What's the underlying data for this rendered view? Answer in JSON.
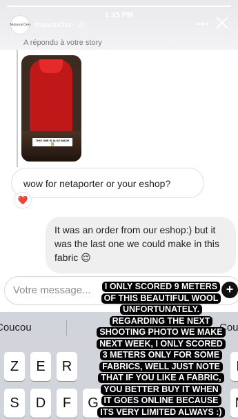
{
  "status": {
    "time": "1:15 PM",
    "story_progress": 1.0
  },
  "header": {
    "avatar_text": "MaisonCléo",
    "author": "maisoncleo",
    "time_ago": "2h",
    "more_icon": "more-horizontal-icon",
    "close_icon": "close-icon"
  },
  "reply": {
    "label": "A répondu à votre story",
    "thumb_caption": "THIS ONE IS ALSO MADE ✅"
  },
  "messages": {
    "incoming": "wow for netaporter or your eshop?",
    "reaction": "❤️",
    "outgoing": "It was an order from our eshop:) but it was the last one we could make in this fabric 😌"
  },
  "composer": {
    "placeholder": "Votre message...",
    "send_icon": "plus-icon"
  },
  "keyboard": {
    "suggestions": [
      "Coucou",
      "Cour"
    ],
    "row1": [
      "Z",
      "E",
      "R",
      "",
      "",
      "",
      "",
      "",
      "",
      "P"
    ],
    "row2": [
      "S",
      "D",
      "F",
      "G",
      "",
      "",
      "",
      "",
      "",
      "M"
    ]
  },
  "overlay": {
    "lines": [
      "I ONLY SCORED 9 METERS",
      "OF THIS BEAUTIFUL WOOL",
      "UNFORTUNATELY.",
      "REGARDING THE NEXT",
      "SHOOTING PHOTO WE MAKE",
      "NEXT WEEK, I ONLY SCORED",
      "3 METERS ONLY FOR SOME",
      "FABRICS, WELL JUST NOTE",
      "THAT IF YOU LIKE A FABRIC,",
      "YOU BETTER BUY IT WHEN",
      "IT GOES ONLINE BECAUSE",
      "ITS VERY LIMITED ALWAYS :)"
    ]
  }
}
